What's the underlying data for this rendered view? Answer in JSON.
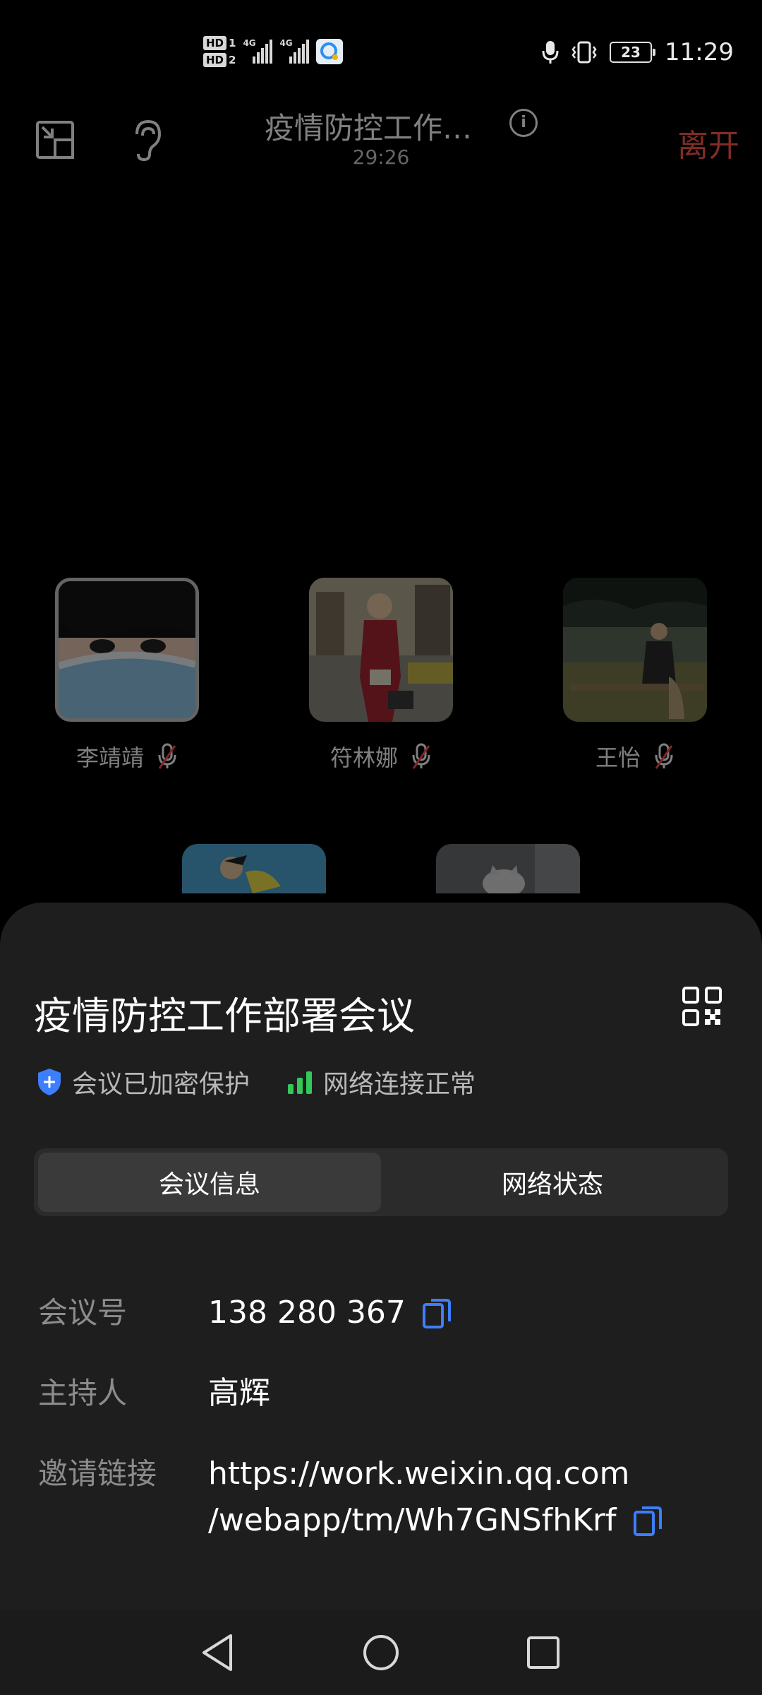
{
  "status_bar": {
    "time": "11:29",
    "battery_level": "23",
    "sim1_label": "HD",
    "sim1_num": "1",
    "sim2_label": "HD",
    "sim2_num": "2",
    "network_type_1": "4G",
    "network_type_2": "4G"
  },
  "header": {
    "title": "疫情防控工作部署会议",
    "elapsed": "29:26",
    "info_glyph": "i",
    "leave_label": "离开",
    "leave_color": "#ff5a4e"
  },
  "participants": [
    {
      "name": "李靖靖",
      "muted": true
    },
    {
      "name": "符林娜",
      "muted": true
    },
    {
      "name": "王怡",
      "muted": true
    }
  ],
  "sheet": {
    "title": "疫情防控工作部署会议",
    "encrypted_label": "会议已加密保护",
    "network_label": "网络连接正常",
    "tabs": [
      {
        "label": "会议信息",
        "active": true
      },
      {
        "label": "网络状态",
        "active": false
      }
    ],
    "meeting_id_label": "会议号",
    "meeting_id": "138 280 367",
    "host_label": "主持人",
    "host": "高辉",
    "invite_label": "邀请链接",
    "invite_line1": "https://work.weixin.qq.com",
    "invite_line2": "/webapp/tm/Wh7GNSfhKrf",
    "accent_color": "#3d7eff",
    "network_color": "#34c759"
  }
}
